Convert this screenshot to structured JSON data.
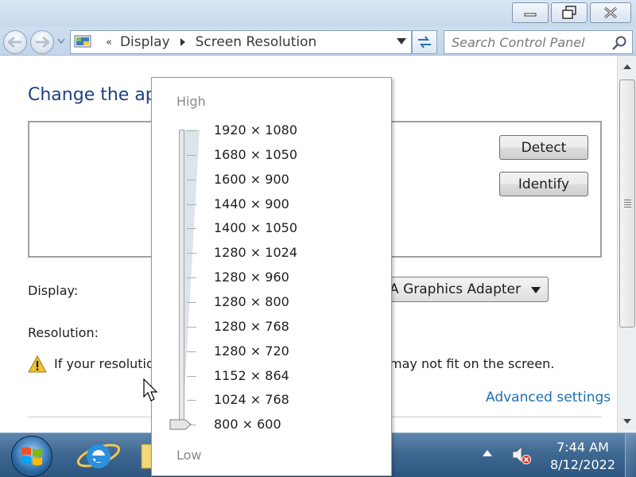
{
  "window": {
    "buttons": [
      "minimize",
      "maximize",
      "close"
    ]
  },
  "address_bar": {
    "overflow": "«",
    "crumbs": [
      "Display",
      "Screen Resolution"
    ]
  },
  "search": {
    "placeholder": "Search Control Panel"
  },
  "content": {
    "heading": "Change the ap",
    "detect_label": "Detect",
    "identify_label": "Identify",
    "display_label": "Display:",
    "display_value": "VGA Graphics Adapter",
    "resolution_label": "Resolution:",
    "warning_left": "If your resolutio",
    "warning_right": "may not fit on the screen.",
    "advanced_link": "Advanced settings"
  },
  "resolution_popup": {
    "high_label": "High",
    "low_label": "Low",
    "options": [
      "1920 × 1080",
      "1680 × 1050",
      "1600 × 900",
      "1440 × 900",
      "1400 × 1050",
      "1280 × 1024",
      "1280 × 960",
      "1280 × 800",
      "1280 × 768",
      "1280 × 720",
      "1152 × 864",
      "1024 × 768",
      "800 × 600"
    ],
    "selected_index": 12
  },
  "taskbar": {
    "time": "7:44 AM",
    "date": "8/12/2022",
    "pinned": [
      "internet-explorer-icon",
      "windows-explorer-icon"
    ]
  },
  "colors": {
    "heading": "#1e3f86",
    "link": "#1f6fb0",
    "taskbar": "#3f6992"
  }
}
